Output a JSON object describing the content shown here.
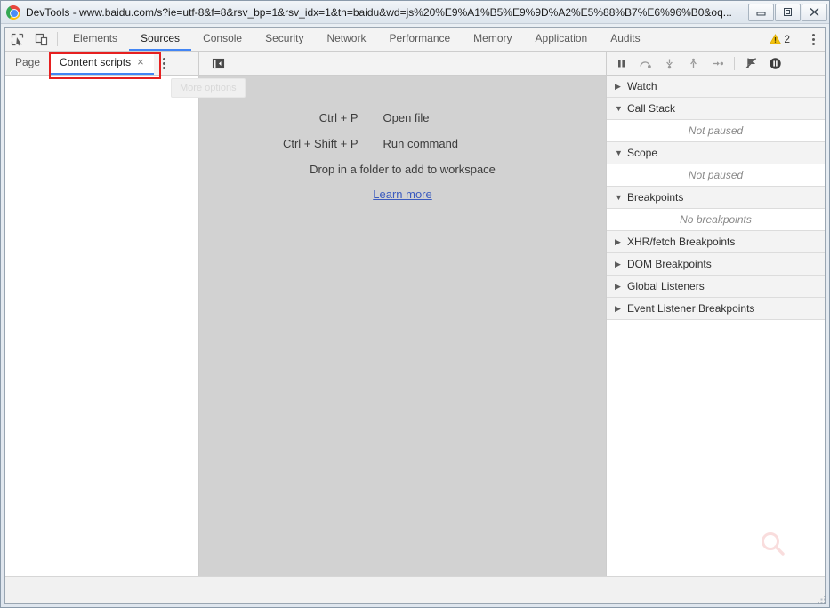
{
  "window": {
    "title": "DevTools - www.baidu.com/s?ie=utf-8&f=8&rsv_bp=1&rsv_idx=1&tn=baidu&wd=js%20%E9%A1%B5%E9%9D%A2%E5%88%B7%E6%96%B0&oq...",
    "logo_icon": "chrome-logo-icon",
    "controls": {
      "minimize_icon": "minimize-icon",
      "maximize_icon": "maximize-icon",
      "close_icon": "close-icon"
    }
  },
  "toolbar": {
    "inspect_icon": "inspect-element-icon",
    "device_icon": "device-toolbar-icon",
    "tabs": [
      {
        "label": "Elements",
        "active": false
      },
      {
        "label": "Sources",
        "active": true
      },
      {
        "label": "Console",
        "active": false
      },
      {
        "label": "Security",
        "active": false
      },
      {
        "label": "Network",
        "active": false
      },
      {
        "label": "Performance",
        "active": false
      },
      {
        "label": "Memory",
        "active": false
      },
      {
        "label": "Application",
        "active": false
      },
      {
        "label": "Audits",
        "active": false
      }
    ],
    "warning": {
      "icon": "warning-triangle-icon",
      "count": "2",
      "color": "#f4c20d"
    },
    "more_icon": "kebab-menu-icon"
  },
  "navigator": {
    "tabs": [
      {
        "label": "Page",
        "active": false,
        "closeable": false
      },
      {
        "label": "Content scripts",
        "active": true,
        "closeable": true,
        "close_label": "×"
      }
    ],
    "more_icon": "kebab-menu-icon",
    "tooltip": "More options",
    "annotation_color": "#e62020"
  },
  "editor": {
    "collapse_icon": "collapse-sidebar-icon",
    "shortcuts": [
      {
        "keys": "Ctrl + P",
        "description": "Open file"
      },
      {
        "keys": "Ctrl + Shift + P",
        "description": "Run command"
      }
    ],
    "drop_hint": "Drop in a folder to add to workspace",
    "learn_more": "Learn more",
    "link_color": "#3b5bbf",
    "background": "#d2d2d2"
  },
  "debugger": {
    "controls": [
      {
        "name": "resume-pause-button",
        "icon": "pause-icon"
      },
      {
        "name": "step-over-button",
        "icon": "step-over-icon"
      },
      {
        "name": "step-into-button",
        "icon": "step-into-icon"
      },
      {
        "name": "step-out-button",
        "icon": "step-out-icon"
      },
      {
        "name": "step-button",
        "icon": "step-icon"
      },
      {
        "name": "deactivate-breakpoints-button",
        "icon": "deactivate-breakpoints-icon"
      },
      {
        "name": "pause-on-exceptions-button",
        "icon": "pause-on-exceptions-icon"
      }
    ],
    "sections": [
      {
        "label": "Watch",
        "expanded": false,
        "empty_text": null
      },
      {
        "label": "Call Stack",
        "expanded": true,
        "empty_text": "Not paused"
      },
      {
        "label": "Scope",
        "expanded": true,
        "empty_text": "Not paused"
      },
      {
        "label": "Breakpoints",
        "expanded": true,
        "empty_text": "No breakpoints"
      },
      {
        "label": "XHR/fetch Breakpoints",
        "expanded": false,
        "empty_text": null
      },
      {
        "label": "DOM Breakpoints",
        "expanded": false,
        "empty_text": null
      },
      {
        "label": "Global Listeners",
        "expanded": false,
        "empty_text": null
      },
      {
        "label": "Event Listener Breakpoints",
        "expanded": false,
        "empty_text": null
      }
    ],
    "expanded_glyph": "▼",
    "collapsed_glyph": "▶",
    "watermark_icon": "search-watermark-icon"
  }
}
